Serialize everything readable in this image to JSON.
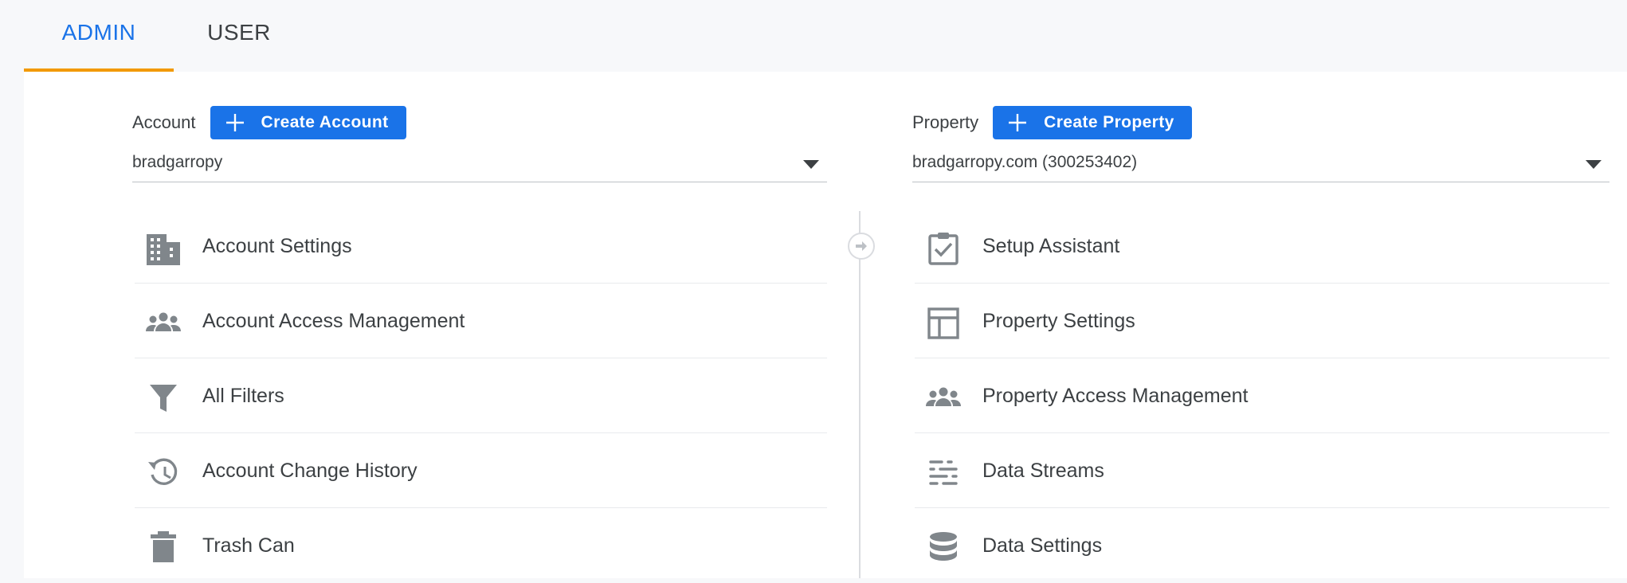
{
  "tabs": [
    {
      "label": "ADMIN",
      "active": true
    },
    {
      "label": "USER",
      "active": false
    }
  ],
  "account": {
    "label": "Account",
    "create_button": "Create Account",
    "selected": "bradgarropy",
    "items": [
      {
        "label": "Account Settings",
        "icon": "building-icon"
      },
      {
        "label": "Account Access Management",
        "icon": "people-icon"
      },
      {
        "label": "All Filters",
        "icon": "filter-icon"
      },
      {
        "label": "Account Change History",
        "icon": "history-icon"
      },
      {
        "label": "Trash Can",
        "icon": "trash-icon"
      }
    ]
  },
  "property": {
    "label": "Property",
    "create_button": "Create Property",
    "selected": "bradgarropy.com (300253402)",
    "items": [
      {
        "label": "Setup Assistant",
        "icon": "clipboard-check-icon"
      },
      {
        "label": "Property Settings",
        "icon": "layout-icon"
      },
      {
        "label": "Property Access Management",
        "icon": "people-icon"
      },
      {
        "label": "Data Streams",
        "icon": "streams-icon"
      },
      {
        "label": "Data Settings",
        "icon": "database-icon"
      }
    ]
  },
  "colors": {
    "accent": "#1a73e8",
    "tab_indicator": "#f29900",
    "icon_gray": "#80868b",
    "text": "#3c4043"
  }
}
